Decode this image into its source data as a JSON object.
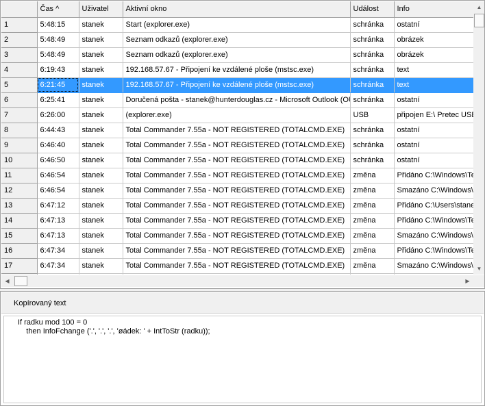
{
  "grid": {
    "columns": [
      "",
      "Čas ^",
      "Uživatel",
      "Aktivní okno",
      "Událost",
      "Info"
    ],
    "selected_row": 4,
    "rows": [
      {
        "n": "1",
        "time": "5:48:15",
        "user": "stanek",
        "window": "Start (explorer.exe)",
        "event": "schránka",
        "info": "ostatní"
      },
      {
        "n": "2",
        "time": "5:48:49",
        "user": "stanek",
        "window": "Seznam odkazů (explorer.exe)",
        "event": "schránka",
        "info": "obrázek"
      },
      {
        "n": "3",
        "time": "5:48:49",
        "user": "stanek",
        "window": "Seznam odkazů (explorer.exe)",
        "event": "schránka",
        "info": "obrázek"
      },
      {
        "n": "4",
        "time": "6:19:43",
        "user": "stanek",
        "window": "192.168.57.67 - Připojení ke vzdálené ploše (mstsc.exe)",
        "event": "schránka",
        "info": "text"
      },
      {
        "n": "5",
        "time": "6:21:45",
        "user": "stanek",
        "window": "192.168.57.67 - Připojení ke vzdálené ploše (mstsc.exe)",
        "event": "schránka",
        "info": "text"
      },
      {
        "n": "6",
        "time": "6:25:41",
        "user": "stanek",
        "window": "Doručená pošta - stanek@hunterdouglas.cz - Microsoft Outlook (OUTLOOK.EXE)",
        "event": "schránka",
        "info": "ostatní"
      },
      {
        "n": "7",
        "time": "6:26:00",
        "user": "stanek",
        "window": " (explorer.exe)",
        "event": "USB",
        "info": "připojen  E:\\    Pretec USB"
      },
      {
        "n": "8",
        "time": "6:44:43",
        "user": "stanek",
        "window": "Total Commander 7.55a - NOT REGISTERED (TOTALCMD.EXE)",
        "event": "schránka",
        "info": "ostatní"
      },
      {
        "n": "9",
        "time": "6:46:40",
        "user": "stanek",
        "window": "Total Commander 7.55a - NOT REGISTERED (TOTALCMD.EXE)",
        "event": "schránka",
        "info": "ostatní"
      },
      {
        "n": "10",
        "time": "6:46:50",
        "user": "stanek",
        "window": "Total Commander 7.55a - NOT REGISTERED (TOTALCMD.EXE)",
        "event": "schránka",
        "info": "ostatní"
      },
      {
        "n": "11",
        "time": "6:46:54",
        "user": "stanek",
        "window": "Total Commander 7.55a - NOT REGISTERED (TOTALCMD.EXE)",
        "event": "změna",
        "info": "Přidáno C:\\Windows\\Temp"
      },
      {
        "n": "12",
        "time": "6:46:54",
        "user": "stanek",
        "window": "Total Commander 7.55a - NOT REGISTERED (TOTALCMD.EXE)",
        "event": "změna",
        "info": "Smazáno C:\\Windows\\Temp"
      },
      {
        "n": "13",
        "time": "6:47:12",
        "user": "stanek",
        "window": "Total Commander 7.55a - NOT REGISTERED (TOTALCMD.EXE)",
        "event": "změna",
        "info": "Přidáno C:\\Users\\stanek"
      },
      {
        "n": "14",
        "time": "6:47:13",
        "user": "stanek",
        "window": "Total Commander 7.55a - NOT REGISTERED (TOTALCMD.EXE)",
        "event": "změna",
        "info": "Přidáno C:\\Windows\\Temp"
      },
      {
        "n": "15",
        "time": "6:47:13",
        "user": "stanek",
        "window": "Total Commander 7.55a - NOT REGISTERED (TOTALCMD.EXE)",
        "event": "změna",
        "info": "Smazáno C:\\Windows\\Temp"
      },
      {
        "n": "16",
        "time": "6:47:34",
        "user": "stanek",
        "window": "Total Commander 7.55a - NOT REGISTERED (TOTALCMD.EXE)",
        "event": "změna",
        "info": "Přidáno C:\\Windows\\Temp"
      },
      {
        "n": "17",
        "time": "6:47:34",
        "user": "stanek",
        "window": "Total Commander 7.55a - NOT REGISTERED (TOTALCMD.EXE)",
        "event": "změna",
        "info": "Smazáno C:\\Windows\\Temp"
      },
      {
        "n": "",
        "time": "",
        "user": "",
        "window": "",
        "event": "",
        "info": ""
      }
    ]
  },
  "scroll": {
    "up_icon": "arrow-up-icon",
    "down_icon": "arrow-down-icon",
    "left_icon": "arrow-left-icon",
    "right_icon": "arrow-right-icon"
  },
  "clipboard": {
    "title": "Kopírovaný text",
    "text": "If radku mod 100 = 0\n    then InfoFchange ('.', '.', '.', 'øádek: ' + IntToStr (radku));"
  }
}
